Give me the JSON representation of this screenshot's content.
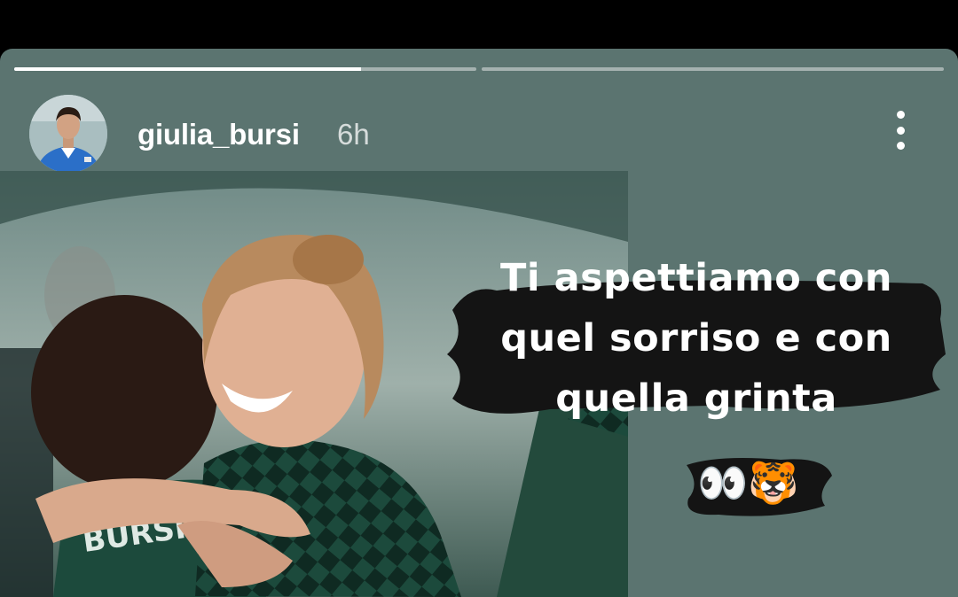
{
  "story": {
    "progress": [
      0.75,
      0.0
    ],
    "user": {
      "username": "giulia_bursi",
      "time_ago": "6h"
    },
    "caption_lines": [
      "Ti aspettiamo con",
      "quel sorriso e con",
      "quella grinta"
    ],
    "emojis": "👀🐯",
    "jersey_text": "BURSI",
    "colors": {
      "background": "#5b7470",
      "jersey_green": "#1c4a3c",
      "brush_black": "#141414"
    },
    "icons": {
      "more": "more-vertical-icon"
    }
  }
}
